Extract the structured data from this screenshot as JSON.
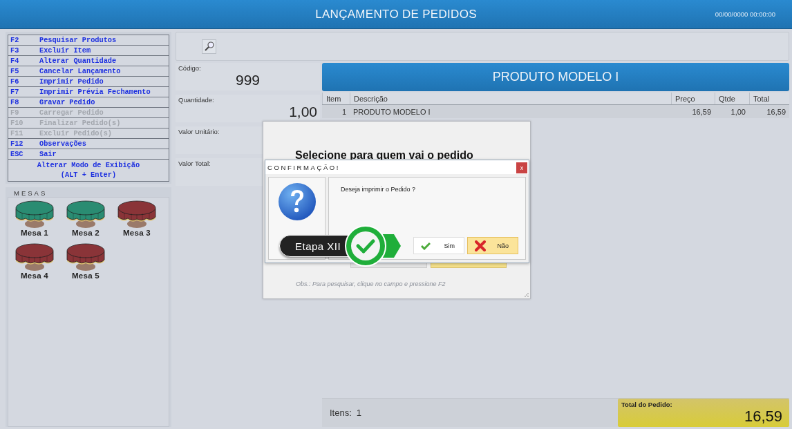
{
  "header": {
    "title": "LANÇAMENTO DE PEDIDOS",
    "datetime": "00/00/0000 00:00:00"
  },
  "shortcuts": [
    {
      "key": "F2",
      "label": "Pesquisar Produtos",
      "disabled": false
    },
    {
      "key": "F3",
      "label": "Excluir Item",
      "disabled": false
    },
    {
      "key": "F4",
      "label": "Alterar Quantidade",
      "disabled": false
    },
    {
      "key": "F5",
      "label": "Cancelar Lançamento",
      "disabled": false
    },
    {
      "key": "F6",
      "label": "Imprimir Pedido",
      "disabled": false
    },
    {
      "key": "F7",
      "label": "Imprimir Prévia Fechamento",
      "disabled": false
    },
    {
      "key": "F8",
      "label": "Gravar Pedido",
      "disabled": false
    },
    {
      "key": "F9",
      "label": "Carregar Pedido",
      "disabled": true
    },
    {
      "key": "F10",
      "label": "Finalizar Pedido(s)",
      "disabled": true
    },
    {
      "key": "F11",
      "label": "Excluir Pedido(s)",
      "disabled": true
    },
    {
      "key": "F12",
      "label": "Observações",
      "disabled": false
    },
    {
      "key": "ESC",
      "label": "Sair",
      "disabled": false
    }
  ],
  "display_mode": [
    "Alterar Modo de Exibição",
    "(ALT + Enter)"
  ],
  "tables_panel": {
    "title": "MESAS",
    "tables": [
      {
        "label": "Mesa 1",
        "color": "#2a8c72"
      },
      {
        "label": "Mesa 2",
        "color": "#2a8c72"
      },
      {
        "label": "Mesa 3",
        "color": "#8a3438"
      },
      {
        "label": "Mesa 4",
        "color": "#8a3438"
      },
      {
        "label": "Mesa 5",
        "color": "#8a3438"
      }
    ]
  },
  "fields": [
    {
      "label": "Código:",
      "value": "999"
    },
    {
      "label": "Quantidade:",
      "value": "1,00"
    },
    {
      "label": "Valor Unitário:"
    },
    {
      "label": "Valor Total:"
    }
  ],
  "product_banner": "PRODUTO MODELO I",
  "table": {
    "columns": [
      "Item",
      "Descrição",
      "Preço",
      "Qtde",
      "Total"
    ],
    "rows": [
      [
        "1",
        "PRODUTO MODELO I",
        "16,59",
        "1,00",
        "16,59"
      ]
    ]
  },
  "footer": {
    "items_label": "Itens:",
    "items_count": "1",
    "total_label": "Total do Pedido:",
    "total_value": "16,59"
  },
  "back_dialog": {
    "heading": "Selecione para quem vai o pedido",
    "note": "Obs.: Para pesquisar, clique no campo e pressione F2"
  },
  "confirm_dialog": {
    "title": "CONFIRMAÇÃO!",
    "close": "x",
    "message": "Deseja imprimir o Pedido ?",
    "buttons": [
      {
        "label": "Sim",
        "kind": "yes"
      },
      {
        "label": "Não",
        "kind": "no"
      }
    ]
  },
  "step_badge": {
    "label": "Etapa XII"
  }
}
